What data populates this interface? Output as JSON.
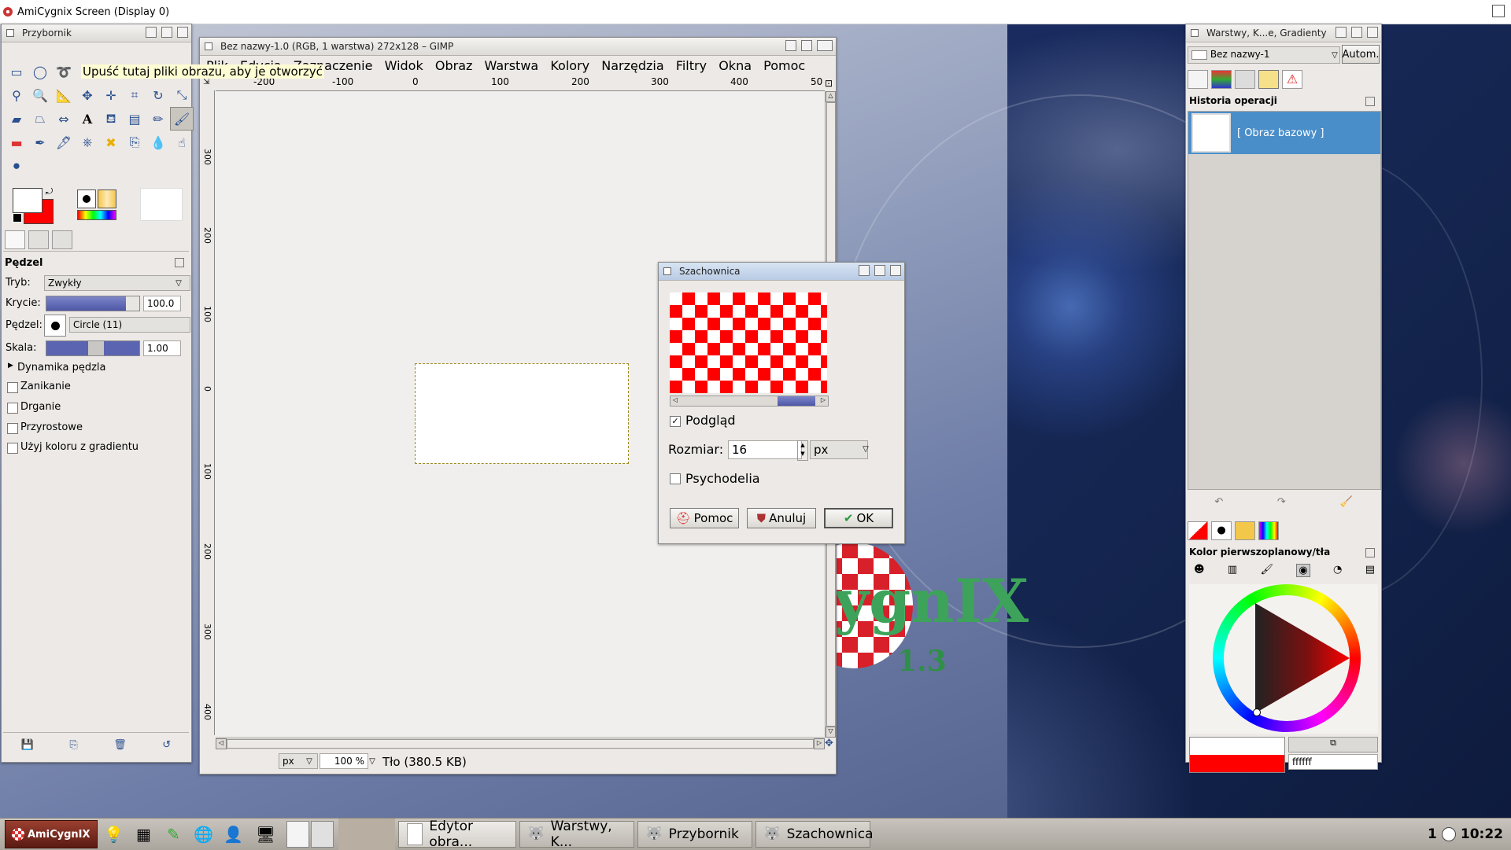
{
  "topbar": {
    "title": "AmiCygnix Screen (Display 0)"
  },
  "toolbox": {
    "title": "Przybornik",
    "tooltip": "Upuść tutaj pliki obrazu, aby je otworzyć",
    "brush_options": {
      "header": "Pędzel",
      "mode_label": "Tryb:",
      "mode_value": "Zwykły",
      "opacity_label": "Krycie:",
      "opacity_value": "100.0",
      "brush_label": "Pędzel:",
      "brush_value": "Circle (11)",
      "scale_label": "Skala:",
      "scale_value": "1.00",
      "dynamics_label": "Dynamika pędzla",
      "fade_label": "Zanikanie",
      "jitter_label": "Drganie",
      "incremental_label": "Przyrostowe",
      "gradient_label": "Użyj koloru z gradientu"
    },
    "fg_color": "#ffffff",
    "bg_color": "#ff0000"
  },
  "image_window": {
    "title": "Bez nazwy-1.0 (RGB, 1 warstwa) 272x128 – GIMP",
    "menu": [
      "Plik",
      "Edycja",
      "Zaznaczenie",
      "Widok",
      "Obraz",
      "Warstwa",
      "Kolory",
      "Narzędzia",
      "Filtry",
      "Okna",
      "Pomoc"
    ],
    "ruler_h": [
      "-200",
      "-100",
      "0",
      "100",
      "200",
      "300",
      "400",
      "50"
    ],
    "ruler_v": [
      "300",
      "200",
      "100",
      "0",
      "100",
      "200",
      "300",
      "400"
    ],
    "status": {
      "unit": "px",
      "zoom": "100 %",
      "layer_info": "Tło (380.5 KB)"
    }
  },
  "dialog": {
    "title": "Szachownica",
    "preview_label": "Podgląd",
    "preview_checked": true,
    "size_label": "Rozmiar:",
    "size_value": "16",
    "unit": "px",
    "psychedelic_label": "Psychodelia",
    "psychedelic_checked": false,
    "buttons": {
      "help": "Pomoc",
      "cancel": "Anuluj",
      "ok": "OK"
    },
    "checker_colors": [
      "#ff0000",
      "#ffffff"
    ]
  },
  "wallpaper": {
    "version": "1.3",
    "logo_text": "ygnIX"
  },
  "layers_panel": {
    "title": "Warstwy, K...e, Gradienty",
    "image_select": "Bez nazwy-1",
    "auto_button": "Autom.",
    "history_header": "Historia operacji",
    "history_items": [
      "[ Obraz bazowy ]"
    ],
    "color_header": "Kolor pierwszoplanowy/tła",
    "hex_value": "ffffff"
  },
  "taskbar": {
    "start_label": "AmiCygnIX",
    "tasks": [
      "Edytor obra...",
      "Warstwy, K...",
      "Przybornik",
      "Szachownica"
    ],
    "workspace": "1",
    "clock": "10:22"
  }
}
